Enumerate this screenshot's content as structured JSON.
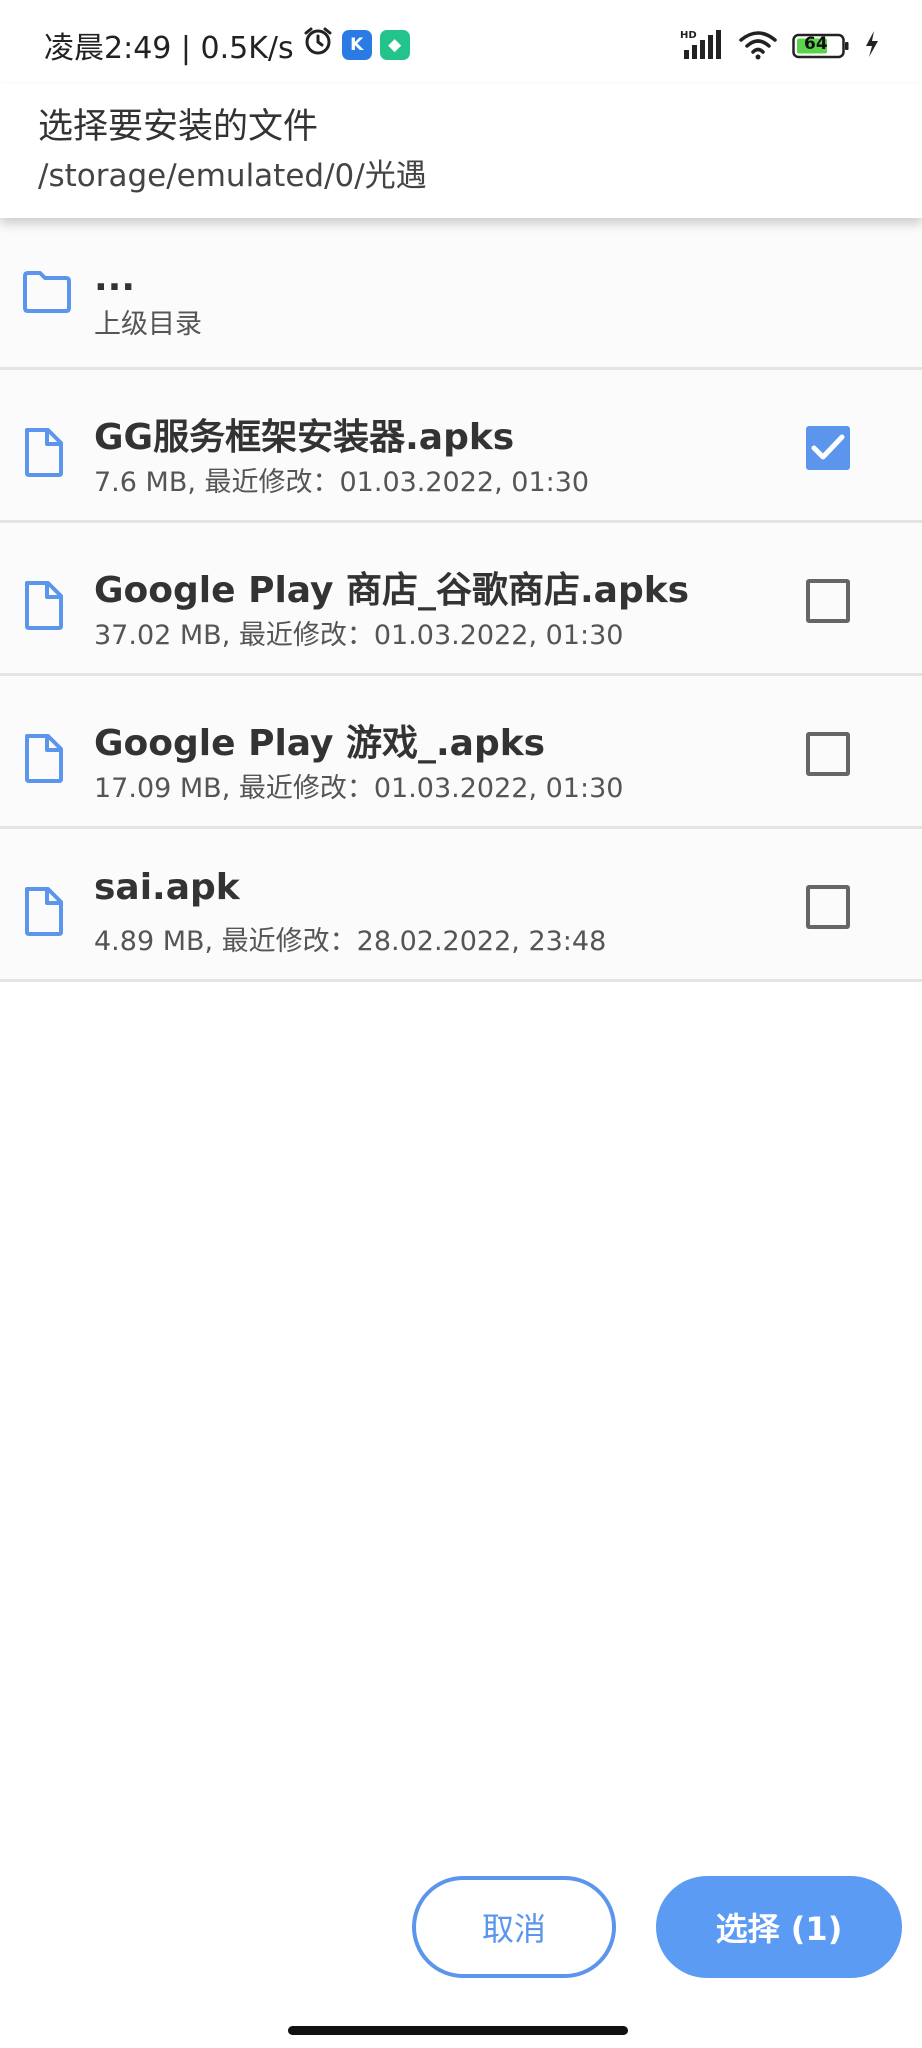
{
  "status_bar": {
    "time_speed": "凌晨2:49 | 0.5K/s",
    "battery": "64",
    "network": "HD"
  },
  "header": {
    "title": "选择要安装的文件",
    "path": "/storage/emulated/0/光遇"
  },
  "parent_dir": {
    "name": "...",
    "label": "上级目录"
  },
  "files": [
    {
      "name": "GG服务框架安装器.apks",
      "meta": "7.6 MB, 最近修改：01.03.2022, 01:30",
      "checked": true
    },
    {
      "name": "Google Play 商店_谷歌商店.apks",
      "meta": "37.02 MB, 最近修改：01.03.2022, 01:30",
      "checked": false
    },
    {
      "name": "Google Play 游戏_.apks",
      "meta": "17.09 MB, 最近修改：01.03.2022, 01:30",
      "checked": false
    },
    {
      "name": "sai.apk",
      "meta": "4.89 MB, 最近修改：28.02.2022, 23:48",
      "checked": false
    }
  ],
  "actions": {
    "cancel_label": "取消",
    "select_label": "选择 (1)"
  },
  "colors": {
    "accent": "#5b95ec",
    "icon": "#5b95ec"
  }
}
